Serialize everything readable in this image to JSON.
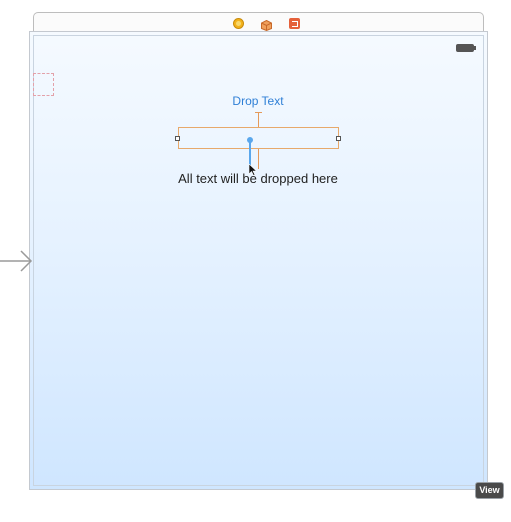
{
  "scene_dock": {
    "icons": [
      "view-controller-icon",
      "first-responder-icon",
      "exit-icon"
    ],
    "colors": {
      "view_controller": "#f2b21c",
      "first_responder": "#e88a3c",
      "exit": "#e5613b"
    }
  },
  "canvas": {
    "status_bar": {
      "battery": "battery-icon"
    },
    "drop_label": "Drop Text",
    "body_text": "All text will be dropped here",
    "accent_color": "#2e7fd6",
    "constraint_color": "#e59a5a"
  },
  "badge": {
    "label": "View"
  }
}
